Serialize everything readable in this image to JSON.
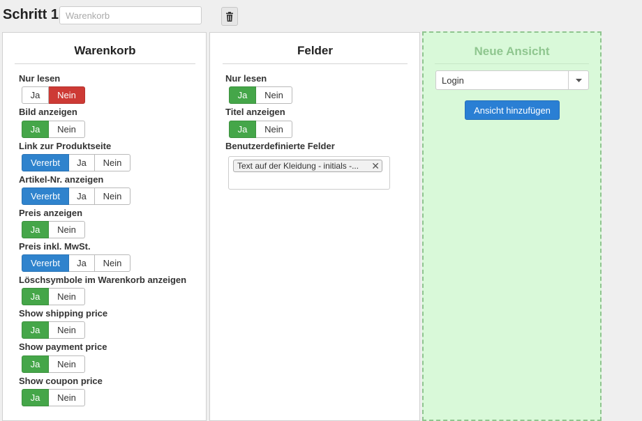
{
  "header": {
    "title": "Schritt 1",
    "name_placeholder": "Warenkorb"
  },
  "icons": {
    "trash": "trash-icon",
    "caret": "caret-down-icon",
    "remove": "close-icon"
  },
  "colors": {
    "yes_active": "#45a649",
    "no_active": "#cd3a35",
    "inherit_active": "#2f83cd",
    "drop_zone": "#d9f9d9"
  },
  "warenkorb": {
    "title": "Warenkorb",
    "options": [
      {
        "label": "Nur lesen",
        "choices": [
          "Ja",
          "Nein"
        ],
        "selected": "Nein"
      },
      {
        "label": "Bild anzeigen",
        "choices": [
          "Ja",
          "Nein"
        ],
        "selected": "Ja"
      },
      {
        "label": "Link zur Produktseite",
        "choices": [
          "Vererbt",
          "Ja",
          "Nein"
        ],
        "selected": "Vererbt"
      },
      {
        "label": "Artikel-Nr. anzeigen",
        "choices": [
          "Vererbt",
          "Ja",
          "Nein"
        ],
        "selected": "Vererbt"
      },
      {
        "label": "Preis anzeigen",
        "choices": [
          "Ja",
          "Nein"
        ],
        "selected": "Ja"
      },
      {
        "label": "Preis inkl. MwSt.",
        "choices": [
          "Vererbt",
          "Ja",
          "Nein"
        ],
        "selected": "Vererbt"
      },
      {
        "label": "Löschsymbole im Warenkorb anzeigen",
        "choices": [
          "Ja",
          "Nein"
        ],
        "selected": "Ja"
      },
      {
        "label": "Show shipping price",
        "choices": [
          "Ja",
          "Nein"
        ],
        "selected": "Ja"
      },
      {
        "label": "Show payment price",
        "choices": [
          "Ja",
          "Nein"
        ],
        "selected": "Ja"
      },
      {
        "label": "Show coupon price",
        "choices": [
          "Ja",
          "Nein"
        ],
        "selected": "Ja"
      }
    ]
  },
  "felder": {
    "title": "Felder",
    "options": [
      {
        "label": "Nur lesen",
        "choices": [
          "Ja",
          "Nein"
        ],
        "selected": "Ja"
      },
      {
        "label": "Titel anzeigen",
        "choices": [
          "Ja",
          "Nein"
        ],
        "selected": "Ja"
      }
    ],
    "custom_fields_label": "Benutzerdefinierte Felder",
    "custom_fields": [
      "Text auf der Kleidung - initials -..."
    ]
  },
  "neue_ansicht": {
    "title": "Neue Ansicht",
    "select_value": "Login",
    "add_button": "Ansicht hinzufügen"
  }
}
